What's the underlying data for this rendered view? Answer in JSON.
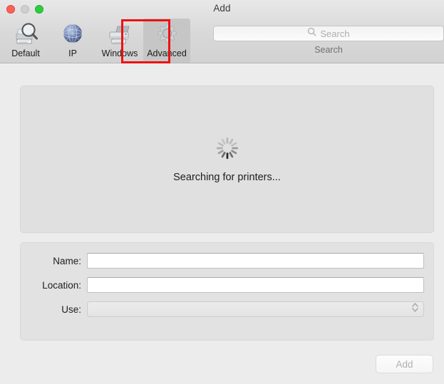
{
  "window": {
    "title": "Add",
    "traffic_lights": [
      {
        "name": "close",
        "color": "#fc6058"
      },
      {
        "name": "minimize",
        "color": "#cfcfcf"
      },
      {
        "name": "zoom",
        "color": "#2ecc40"
      }
    ]
  },
  "toolbar": {
    "tabs": [
      {
        "label": "Default",
        "icon": "printer-magnifier-icon",
        "selected": false
      },
      {
        "label": "IP",
        "icon": "globe-icon",
        "selected": false
      },
      {
        "label": "Windows",
        "icon": "printer-icon",
        "selected": false
      },
      {
        "label": "Advanced",
        "icon": "gear-icon",
        "selected": true
      }
    ],
    "search": {
      "placeholder": "Search",
      "value": "",
      "icon": "search-icon",
      "caption": "Search"
    }
  },
  "annotation": {
    "target": "Advanced",
    "color": "#ee1111"
  },
  "main": {
    "list_panel": {
      "spinner": "activity-spinner-icon",
      "status_text": "Searching for printers..."
    },
    "form": {
      "fields": [
        {
          "label": "Name:",
          "type": "text",
          "value": "",
          "placeholder": ""
        },
        {
          "label": "Location:",
          "type": "text",
          "value": "",
          "placeholder": ""
        },
        {
          "label": "Use:",
          "type": "popup",
          "value": "",
          "icon": "chevron-updown-icon",
          "disabled": true
        }
      ]
    },
    "add_button": {
      "label": "Add",
      "disabled": true
    }
  }
}
